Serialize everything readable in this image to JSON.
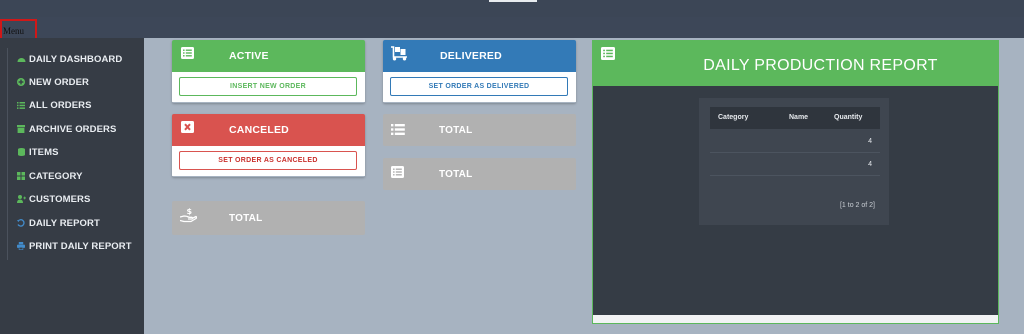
{
  "menu_label": "Menu",
  "sidebar": {
    "items": [
      {
        "label": "DAILY DASHBOARD",
        "icon": "dashboard-icon",
        "color": "#5cb85c"
      },
      {
        "label": "NEW ORDER",
        "icon": "plus-circle-icon",
        "color": "#5cb85c"
      },
      {
        "label": "ALL ORDERS",
        "icon": "list-icon",
        "color": "#5cb85c"
      },
      {
        "label": "ARCHIVE ORDERS",
        "icon": "archive-icon",
        "color": "#5cb85c"
      },
      {
        "label": "ITEMS",
        "icon": "database-icon",
        "color": "#5cb85c"
      },
      {
        "label": "CATEGORY",
        "icon": "grid-icon",
        "color": "#5cb85c"
      },
      {
        "label": "CUSTOMERS",
        "icon": "user-plus-icon",
        "color": "#5cb85c"
      },
      {
        "label": "DAILY REPORT",
        "icon": "history-icon",
        "color": "#428bca"
      },
      {
        "label": "PRINT DAILY REPORT",
        "icon": "print-icon",
        "color": "#428bca"
      }
    ]
  },
  "cards": {
    "active": {
      "title": "ACTIVE",
      "button": "INSERT NEW ORDER",
      "color": "#5cb85c"
    },
    "delivered": {
      "title": "DELIVERED",
      "button": "SET ORDER AS DELIVERED",
      "color": "#337ab7"
    },
    "canceled": {
      "title": "CANCELED",
      "button": "SET ORDER AS CANCELED",
      "color": "#d9534f"
    }
  },
  "totals": {
    "total_1": "TOTAL",
    "total_2": "TOTAL",
    "total_3": "TOTAL"
  },
  "report": {
    "title": "DAILY PRODUCTION REPORT",
    "columns": [
      "Category",
      "Name",
      "Quantity"
    ],
    "rows": [
      {
        "category": "",
        "name": "",
        "quantity": "4"
      },
      {
        "category": "",
        "name": "",
        "quantity": "4"
      }
    ],
    "pager": "[1 to 2 of 2]"
  }
}
